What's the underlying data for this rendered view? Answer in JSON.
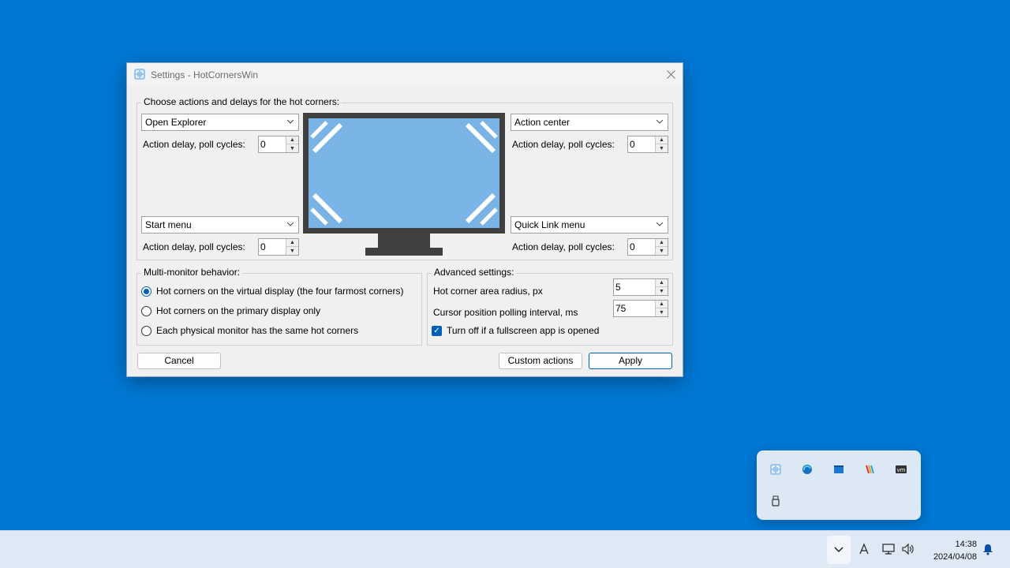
{
  "dialog": {
    "title": "Settings - HotCornersWin",
    "corners_group_label": "Choose actions and delays for the hot corners:",
    "delay_label": "Action delay, poll cycles:",
    "corners": {
      "top_left": {
        "action": "Open Explorer",
        "delay": "0"
      },
      "top_right": {
        "action": "Action center",
        "delay": "0"
      },
      "bottom_left": {
        "action": "Start menu",
        "delay": "0"
      },
      "bottom_right": {
        "action": "Quick Link menu",
        "delay": "0"
      }
    },
    "multi_monitor": {
      "label": "Multi-monitor behavior:",
      "options": [
        {
          "label": "Hot corners on the virtual display (the four farmost corners)",
          "selected": true
        },
        {
          "label": "Hot corners on the primary display only",
          "selected": false
        },
        {
          "label": "Each physical monitor has the same hot corners",
          "selected": false
        }
      ]
    },
    "advanced": {
      "label": "Advanced settings:",
      "radius_label": "Hot corner area radius, px",
      "radius_value": "5",
      "interval_label": "Cursor position polling interval, ms",
      "interval_value": "75",
      "fullscreen_label": "Turn off if a fullscreen app is opened",
      "fullscreen_checked": true
    },
    "buttons": {
      "cancel": "Cancel",
      "custom_actions": "Custom actions",
      "apply": "Apply"
    }
  },
  "tray_popup": {
    "icons": [
      "hotcorners-icon",
      "edge-icon",
      "terminal-icon",
      "stripes-icon",
      "vm-icon",
      "usb-icon"
    ]
  },
  "taskbar": {
    "time": "14:38",
    "date": "2024/04/08",
    "icons": [
      "show-hidden-icons-chevron",
      "ime-a-icon",
      "network-icon",
      "volume-icon",
      "notification-bell-icon"
    ]
  },
  "colors": {
    "desktop": "#0078d4",
    "accent": "#005fb8",
    "monitor_screen": "#7ab4e6",
    "monitor_frame": "#404040"
  }
}
